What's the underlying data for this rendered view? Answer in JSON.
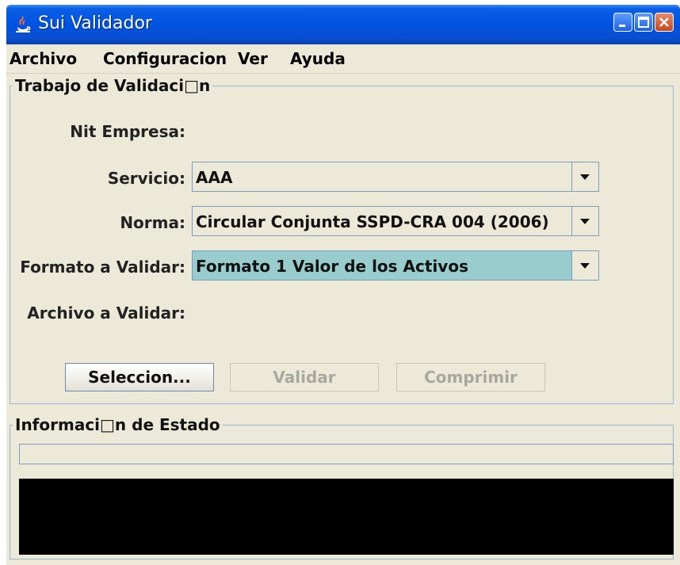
{
  "window": {
    "title": "Sui Validador"
  },
  "menu": [
    "Archivo",
    "Configuracion",
    "Ver",
    "Ayuda"
  ],
  "validation_panel": {
    "title": "Trabajo de Validaci□n",
    "nit_label": "Nit Empresa:",
    "servicio_label": "Servicio:",
    "servicio_value": "AAA",
    "norma_label": "Norma:",
    "norma_value": "Circular Conjunta SSPD-CRA 004 (2006)",
    "formato_label": "Formato a Validar:",
    "formato_value": "Formato 1 Valor de los Activos",
    "archivo_label": "Archivo a Validar:",
    "buttons": {
      "seleccion": "Seleccion...",
      "validar": "Validar",
      "comprimir": "Comprimir"
    }
  },
  "status_panel": {
    "title": "Informaci□n de Estado",
    "progress": 0
  },
  "colors": {
    "titlebar": "#0053e0",
    "highlight": "#99cccc",
    "console": "#000000",
    "window_bg": "#ece9d8"
  }
}
